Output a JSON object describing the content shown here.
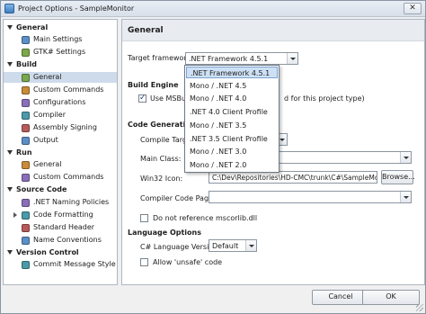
{
  "window": {
    "title": "Project Options - SampleMonitor",
    "close_glyph": "✕"
  },
  "sidebar": {
    "categories": [
      {
        "label": "General",
        "items": [
          {
            "label": "Main Settings",
            "icon": "settings-icon"
          },
          {
            "label": "GTK# Settings",
            "icon": "gtk-icon"
          }
        ]
      },
      {
        "label": "Build",
        "items": [
          {
            "label": "General",
            "icon": "build-general-icon",
            "selected": true
          },
          {
            "label": "Custom Commands",
            "icon": "custom-commands-icon"
          },
          {
            "label": "Configurations",
            "icon": "configurations-icon"
          },
          {
            "label": "Compiler",
            "icon": "compiler-icon"
          },
          {
            "label": "Assembly Signing",
            "icon": "assembly-signing-icon"
          },
          {
            "label": "Output",
            "icon": "output-icon"
          }
        ]
      },
      {
        "label": "Run",
        "items": [
          {
            "label": "General",
            "icon": "run-general-icon"
          },
          {
            "label": "Custom Commands",
            "icon": "run-custom-commands-icon"
          }
        ]
      },
      {
        "label": "Source Code",
        "items": [
          {
            "label": ".NET Naming Policies",
            "icon": "naming-policies-icon"
          },
          {
            "label": "Code Formatting",
            "icon": "code-formatting-icon",
            "expandable": true
          },
          {
            "label": "Standard Header",
            "icon": "standard-header-icon"
          },
          {
            "label": "Name Conventions",
            "icon": "name-conventions-icon"
          }
        ]
      },
      {
        "label": "Version Control",
        "items": [
          {
            "label": "Commit Message Style",
            "icon": "commit-style-icon"
          }
        ]
      }
    ]
  },
  "panel": {
    "title": "General",
    "target_framework": {
      "label": "Target framework:",
      "value": ".NET Framework 4.5.1"
    },
    "build_engine": {
      "heading": "Build Engine",
      "use_msbuild_prefix": "Use MSBuild",
      "use_msbuild_suffix": "d for this project type)",
      "checked": true
    },
    "code_generation": {
      "heading": "Code Generation",
      "compile_target_label": "Compile Target",
      "main_class_label": "Main Class:",
      "win32_icon_label": "Win32 Icon:",
      "win32_icon_value": "C:\\Dev\\Repositories\\HD-CMC\\trunk\\C#\\SampleMon",
      "browse_label": "Browse...",
      "code_page_label": "Compiler Code Page:",
      "no_mscorlib_label": "Do not reference mscorlib.dll"
    },
    "language_options": {
      "heading": "Language Options",
      "csharp_version_label": "C# Language Version:",
      "csharp_version_value": "Default",
      "allow_unsafe_label": "Allow 'unsafe' code"
    }
  },
  "dropdown": {
    "options": [
      ".NET Framework 4.5.1",
      "Mono / .NET 4.5",
      "Mono / .NET 4.0",
      ".NET 4.0 Client Profile",
      "Mono / .NET 3.5",
      ".NET 3.5 Client Profile",
      "Mono / .NET 3.0",
      "Mono / .NET 2.0"
    ],
    "highlighted": ".NET Framework 4.5.1"
  },
  "footer": {
    "cancel_label": "Cancel",
    "ok_label": "OK"
  }
}
